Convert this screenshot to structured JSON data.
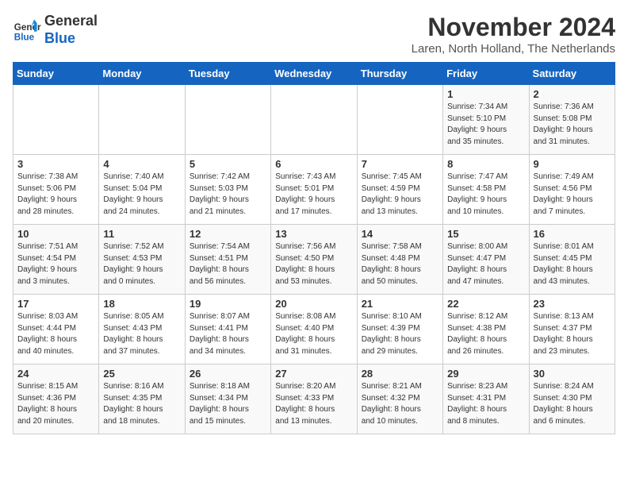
{
  "logo": {
    "line1": "General",
    "line2": "Blue"
  },
  "title": "November 2024",
  "location": "Laren, North Holland, The Netherlands",
  "weekdays": [
    "Sunday",
    "Monday",
    "Tuesday",
    "Wednesday",
    "Thursday",
    "Friday",
    "Saturday"
  ],
  "weeks": [
    [
      {
        "day": "",
        "info": ""
      },
      {
        "day": "",
        "info": ""
      },
      {
        "day": "",
        "info": ""
      },
      {
        "day": "",
        "info": ""
      },
      {
        "day": "",
        "info": ""
      },
      {
        "day": "1",
        "info": "Sunrise: 7:34 AM\nSunset: 5:10 PM\nDaylight: 9 hours\nand 35 minutes."
      },
      {
        "day": "2",
        "info": "Sunrise: 7:36 AM\nSunset: 5:08 PM\nDaylight: 9 hours\nand 31 minutes."
      }
    ],
    [
      {
        "day": "3",
        "info": "Sunrise: 7:38 AM\nSunset: 5:06 PM\nDaylight: 9 hours\nand 28 minutes."
      },
      {
        "day": "4",
        "info": "Sunrise: 7:40 AM\nSunset: 5:04 PM\nDaylight: 9 hours\nand 24 minutes."
      },
      {
        "day": "5",
        "info": "Sunrise: 7:42 AM\nSunset: 5:03 PM\nDaylight: 9 hours\nand 21 minutes."
      },
      {
        "day": "6",
        "info": "Sunrise: 7:43 AM\nSunset: 5:01 PM\nDaylight: 9 hours\nand 17 minutes."
      },
      {
        "day": "7",
        "info": "Sunrise: 7:45 AM\nSunset: 4:59 PM\nDaylight: 9 hours\nand 13 minutes."
      },
      {
        "day": "8",
        "info": "Sunrise: 7:47 AM\nSunset: 4:58 PM\nDaylight: 9 hours\nand 10 minutes."
      },
      {
        "day": "9",
        "info": "Sunrise: 7:49 AM\nSunset: 4:56 PM\nDaylight: 9 hours\nand 7 minutes."
      }
    ],
    [
      {
        "day": "10",
        "info": "Sunrise: 7:51 AM\nSunset: 4:54 PM\nDaylight: 9 hours\nand 3 minutes."
      },
      {
        "day": "11",
        "info": "Sunrise: 7:52 AM\nSunset: 4:53 PM\nDaylight: 9 hours\nand 0 minutes."
      },
      {
        "day": "12",
        "info": "Sunrise: 7:54 AM\nSunset: 4:51 PM\nDaylight: 8 hours\nand 56 minutes."
      },
      {
        "day": "13",
        "info": "Sunrise: 7:56 AM\nSunset: 4:50 PM\nDaylight: 8 hours\nand 53 minutes."
      },
      {
        "day": "14",
        "info": "Sunrise: 7:58 AM\nSunset: 4:48 PM\nDaylight: 8 hours\nand 50 minutes."
      },
      {
        "day": "15",
        "info": "Sunrise: 8:00 AM\nSunset: 4:47 PM\nDaylight: 8 hours\nand 47 minutes."
      },
      {
        "day": "16",
        "info": "Sunrise: 8:01 AM\nSunset: 4:45 PM\nDaylight: 8 hours\nand 43 minutes."
      }
    ],
    [
      {
        "day": "17",
        "info": "Sunrise: 8:03 AM\nSunset: 4:44 PM\nDaylight: 8 hours\nand 40 minutes."
      },
      {
        "day": "18",
        "info": "Sunrise: 8:05 AM\nSunset: 4:43 PM\nDaylight: 8 hours\nand 37 minutes."
      },
      {
        "day": "19",
        "info": "Sunrise: 8:07 AM\nSunset: 4:41 PM\nDaylight: 8 hours\nand 34 minutes."
      },
      {
        "day": "20",
        "info": "Sunrise: 8:08 AM\nSunset: 4:40 PM\nDaylight: 8 hours\nand 31 minutes."
      },
      {
        "day": "21",
        "info": "Sunrise: 8:10 AM\nSunset: 4:39 PM\nDaylight: 8 hours\nand 29 minutes."
      },
      {
        "day": "22",
        "info": "Sunrise: 8:12 AM\nSunset: 4:38 PM\nDaylight: 8 hours\nand 26 minutes."
      },
      {
        "day": "23",
        "info": "Sunrise: 8:13 AM\nSunset: 4:37 PM\nDaylight: 8 hours\nand 23 minutes."
      }
    ],
    [
      {
        "day": "24",
        "info": "Sunrise: 8:15 AM\nSunset: 4:36 PM\nDaylight: 8 hours\nand 20 minutes."
      },
      {
        "day": "25",
        "info": "Sunrise: 8:16 AM\nSunset: 4:35 PM\nDaylight: 8 hours\nand 18 minutes."
      },
      {
        "day": "26",
        "info": "Sunrise: 8:18 AM\nSunset: 4:34 PM\nDaylight: 8 hours\nand 15 minutes."
      },
      {
        "day": "27",
        "info": "Sunrise: 8:20 AM\nSunset: 4:33 PM\nDaylight: 8 hours\nand 13 minutes."
      },
      {
        "day": "28",
        "info": "Sunrise: 8:21 AM\nSunset: 4:32 PM\nDaylight: 8 hours\nand 10 minutes."
      },
      {
        "day": "29",
        "info": "Sunrise: 8:23 AM\nSunset: 4:31 PM\nDaylight: 8 hours\nand 8 minutes."
      },
      {
        "day": "30",
        "info": "Sunrise: 8:24 AM\nSunset: 4:30 PM\nDaylight: 8 hours\nand 6 minutes."
      }
    ]
  ]
}
